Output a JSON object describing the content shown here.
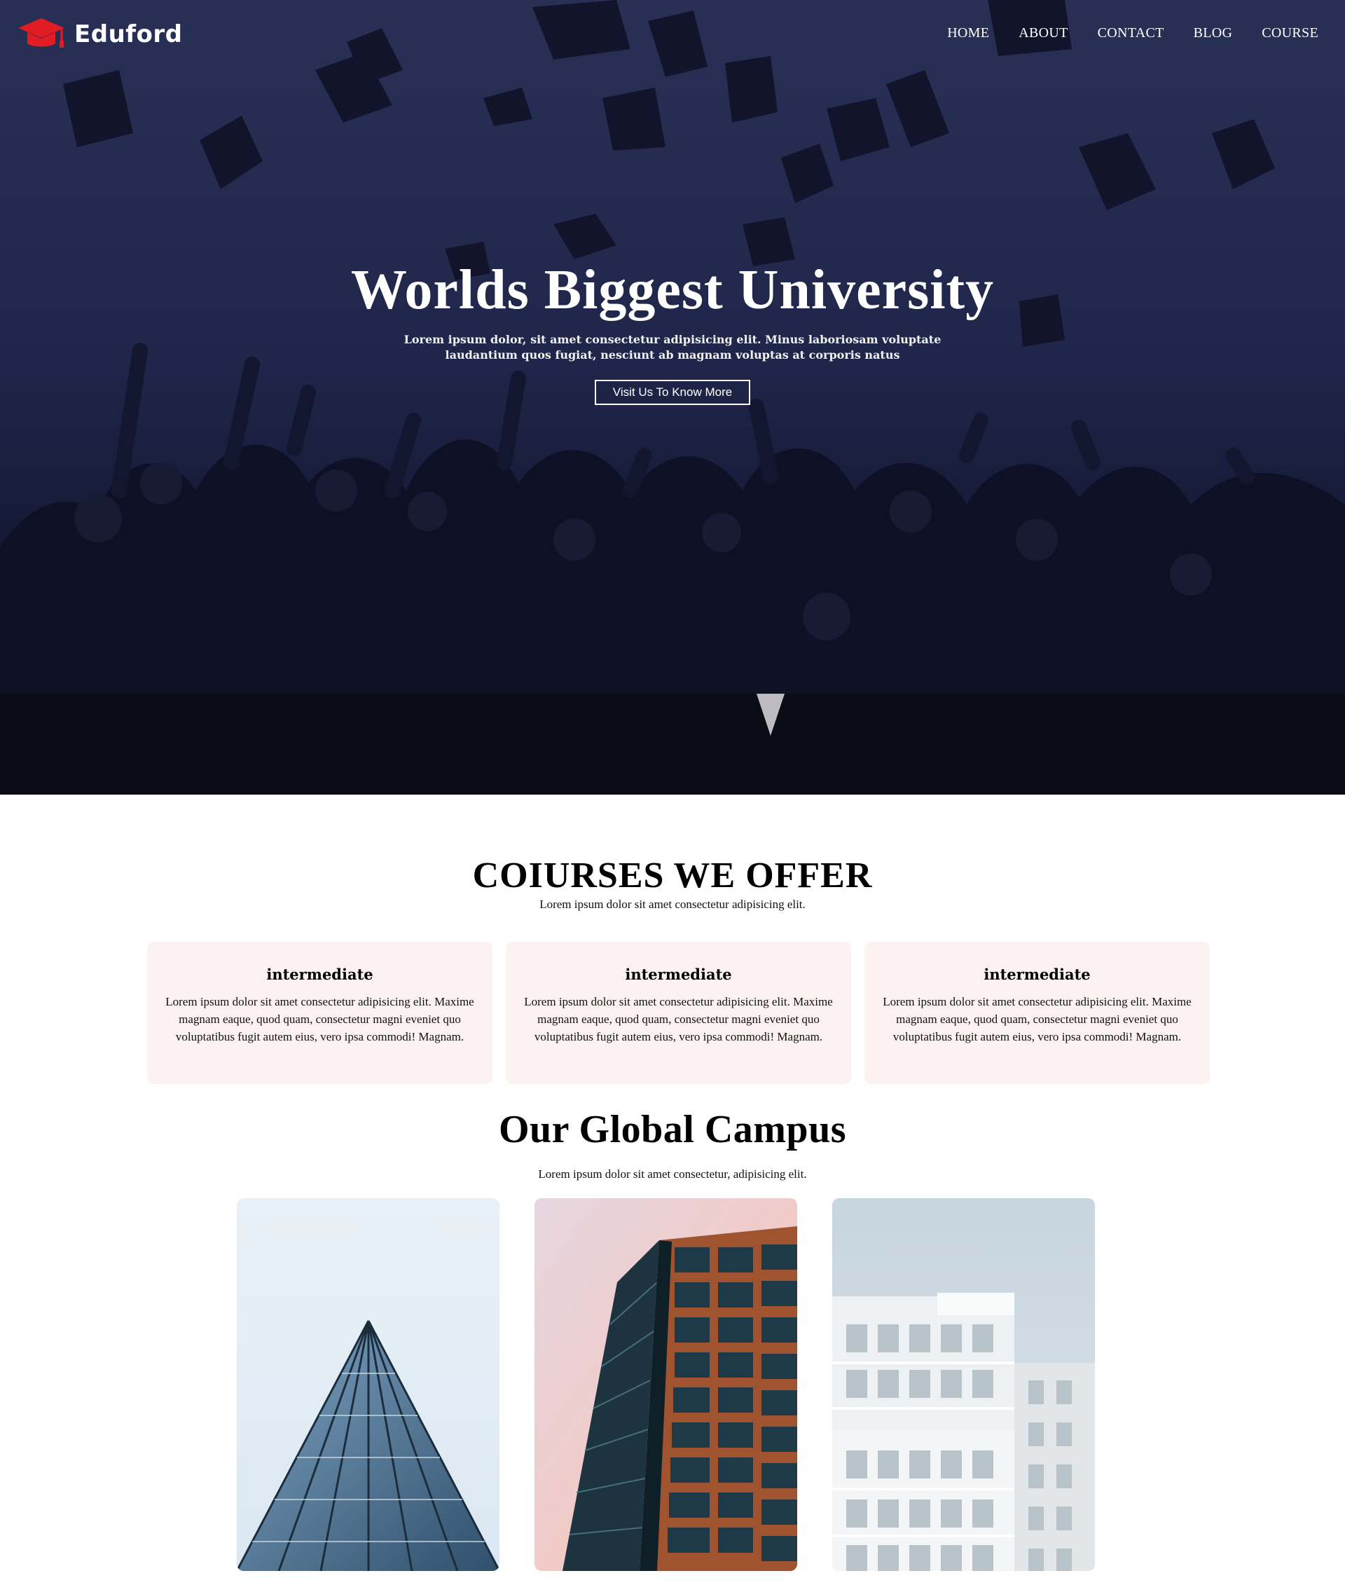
{
  "brand": {
    "name": "Eduford",
    "accent": "#e31b23"
  },
  "nav": {
    "items": [
      {
        "label": "HOME"
      },
      {
        "label": "ABOUT"
      },
      {
        "label": "CONTACT"
      },
      {
        "label": "BLOG"
      },
      {
        "label": "COURSE"
      }
    ]
  },
  "hero": {
    "title": "Worlds Biggest University",
    "subtitle": "Lorem ipsum dolor, sit amet consectetur adipisicing elit. Minus laboriosam voluptate laudantium quos fugiat, nesciunt ab magnam voluptas at corporis natus",
    "button_label": "Visit Us To Know More"
  },
  "courses": {
    "title": "COIURSES WE OFFER",
    "subtitle": "Lorem ipsum dolor sit amet consectetur adipisicing elit.",
    "cards": [
      {
        "title": "intermediate",
        "text": "Lorem ipsum dolor sit amet consectetur adipisicing elit. Maxime magnam eaque, quod quam, consectetur magni eveniet quo voluptatibus fugit autem eius, vero ipsa commodi! Magnam."
      },
      {
        "title": "intermediate",
        "text": "Lorem ipsum dolor sit amet consectetur adipisicing elit. Maxime magnam eaque, quod quam, consectetur magni eveniet quo voluptatibus fugit autem eius, vero ipsa commodi! Magnam."
      },
      {
        "title": "intermediate",
        "text": "Lorem ipsum dolor sit amet consectetur adipisicing elit. Maxime magnam eaque, quod quam, consectetur magni eveniet quo voluptatibus fugit autem eius, vero ipsa commodi! Magnam."
      }
    ],
    "card_bg": "#fdf2f2"
  },
  "campus": {
    "title": "Our Global Campus",
    "subtitle": "Lorem ipsum dolor sit amet consectetur, adipisicing elit."
  }
}
